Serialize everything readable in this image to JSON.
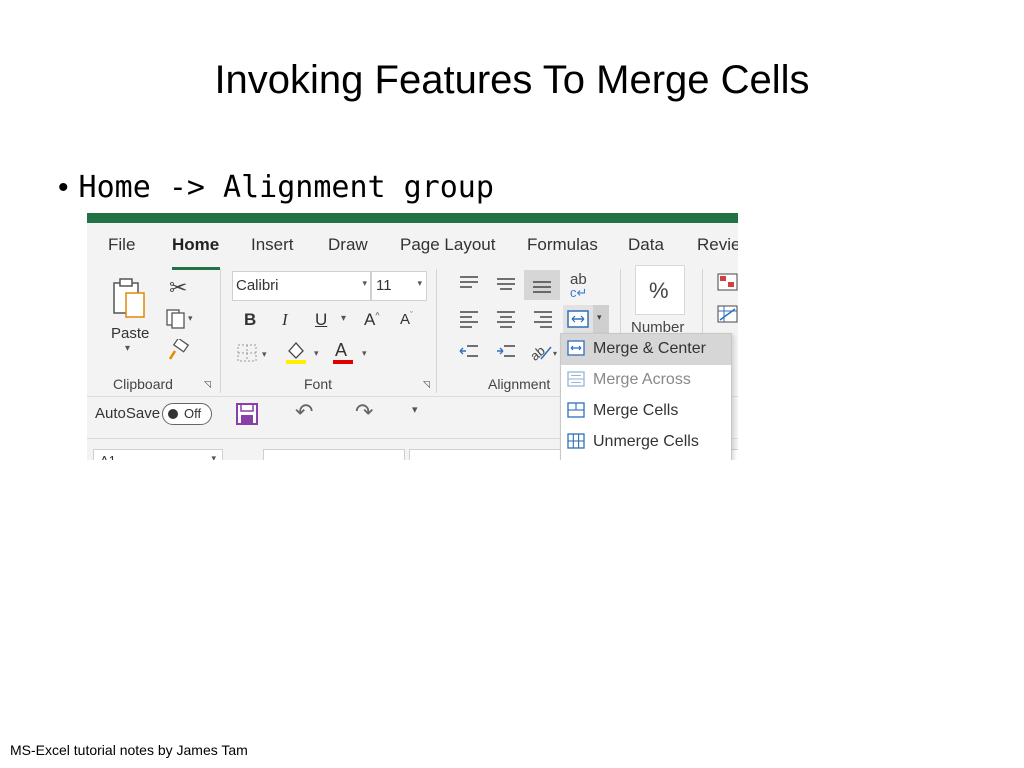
{
  "slide": {
    "title": "Invoking Features To Merge Cells",
    "bullet": "Home -> Alignment group",
    "footer": "MS-Excel tutorial notes by James Tam"
  },
  "excel": {
    "accent": "#217346",
    "tabs": [
      "File",
      "Home",
      "Insert",
      "Draw",
      "Page Layout",
      "Formulas",
      "Data",
      "Revie"
    ],
    "active_tab": "Home",
    "clipboard": {
      "paste_label": "Paste",
      "group_label": "Clipboard"
    },
    "font": {
      "name": "Calibri",
      "size": "11",
      "bold": "B",
      "italic": "I",
      "underline": "U",
      "grow": "A",
      "shrink": "A",
      "font_color": "A",
      "group_label": "Font"
    },
    "alignment": {
      "wrap": "ab",
      "group_label": "Alignment"
    },
    "number": {
      "symbol": "%",
      "label": "Number"
    },
    "qat": {
      "autosave_label": "AutoSave",
      "toggle_label": "Off"
    },
    "name_box": "A1",
    "merge_menu": [
      {
        "label": "Merge & Center",
        "highlighted": true,
        "enabled": true,
        "icon": "merge-center-icon"
      },
      {
        "label": "Merge Across",
        "highlighted": false,
        "enabled": false,
        "icon": "merge-across-icon"
      },
      {
        "label": "Merge Cells",
        "highlighted": false,
        "enabled": true,
        "icon": "merge-cells-icon"
      },
      {
        "label": "Unmerge Cells",
        "highlighted": false,
        "enabled": true,
        "icon": "unmerge-cells-icon"
      }
    ]
  }
}
